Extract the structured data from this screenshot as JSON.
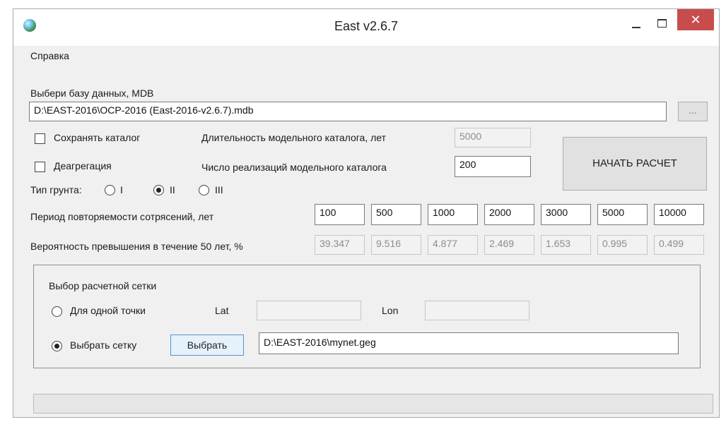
{
  "window": {
    "title": "East v2.6.7",
    "close_symbol": "✕"
  },
  "menu": {
    "help": "Справка"
  },
  "database": {
    "label": "Выбери базу данных, MDB",
    "path": "D:\\EAST-2016\\OCP-2016 (East-2016-v2.6.7).mdb",
    "browse_label": "..."
  },
  "options": {
    "save_catalog": {
      "label": "Сохранять каталог",
      "checked": false
    },
    "deaggregation": {
      "label": "Деагрегация",
      "checked": false
    },
    "catalog_duration_label": "Длительность модельного каталога, лет",
    "catalog_duration_value": "5000",
    "realizations_label": "Число реализаций модельного каталога",
    "realizations_value": "200",
    "start_button": "НАЧАТЬ РАСЧЕТ"
  },
  "soil": {
    "label": "Тип грунта:",
    "options": [
      "I",
      "II",
      "III"
    ],
    "selected": "II"
  },
  "periods": {
    "label": "Период повторяемости сотрясений, лет",
    "values": [
      "100",
      "500",
      "1000",
      "2000",
      "3000",
      "5000",
      "10000"
    ]
  },
  "probabilities": {
    "label": "Вероятность превышения в течение 50 лет, %",
    "values": [
      "39.347",
      "9.516",
      "4.877",
      "2.469",
      "1.653",
      "0.995",
      "0.499"
    ]
  },
  "grid": {
    "title": "Выбор расчетной сетки",
    "single_point_label": "Для одной точки",
    "lat_label": "Lat",
    "lat_value": "",
    "lon_label": "Lon",
    "lon_value": "",
    "select_grid_label": "Выбрать сетку",
    "select_button": "Выбрать",
    "grid_path": "D:\\EAST-2016\\mynet.geg",
    "selected_mode": "select_grid"
  },
  "progress": {
    "percent": 0
  }
}
